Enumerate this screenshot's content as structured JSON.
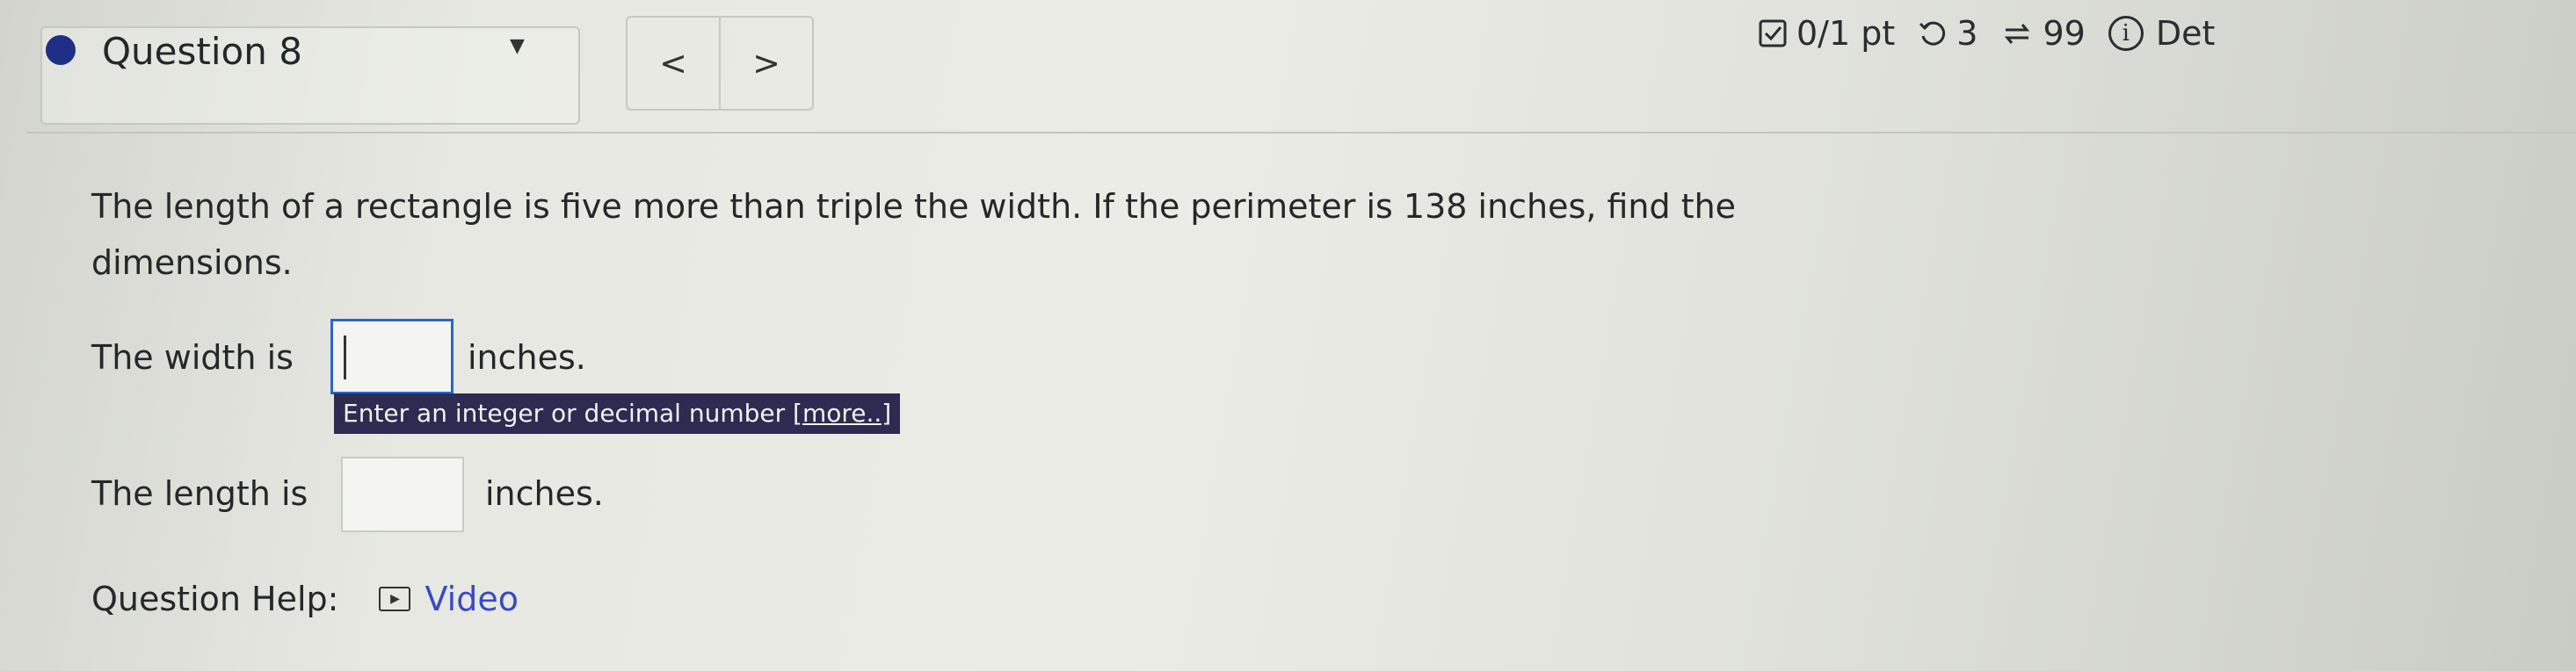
{
  "header": {
    "question_title": "Question 8",
    "nav_prev": "<",
    "nav_next": ">"
  },
  "status": {
    "score": "0/1 pt",
    "retries": "3",
    "attempts": "99",
    "details_label": "Det"
  },
  "problem": {
    "text": "The length of a rectangle is five more than triple the width. If the perimeter is 138 inches, find the dimensions."
  },
  "answers": {
    "width": {
      "prefix": "The width is",
      "suffix": "inches.",
      "value": ""
    },
    "length": {
      "prefix": "The length is",
      "suffix": "inches.",
      "value": ""
    }
  },
  "hint": {
    "text": "Enter an integer or decimal number",
    "more": "[more..]"
  },
  "help": {
    "label": "Question Help:",
    "video_label": "Video"
  },
  "icons": {
    "status_dot": "question-status-dot",
    "dropdown": "chevron-down-icon",
    "score": "checkbox-icon",
    "retry": "retry-icon",
    "attempts": "cycle-icon",
    "info": "info-icon",
    "video": "video-icon"
  },
  "colors": {
    "status_dot": "#1f2f86",
    "hint_bg": "#2e2a52",
    "link": "#3a49c9",
    "active_input_border": "#2b66c9"
  }
}
